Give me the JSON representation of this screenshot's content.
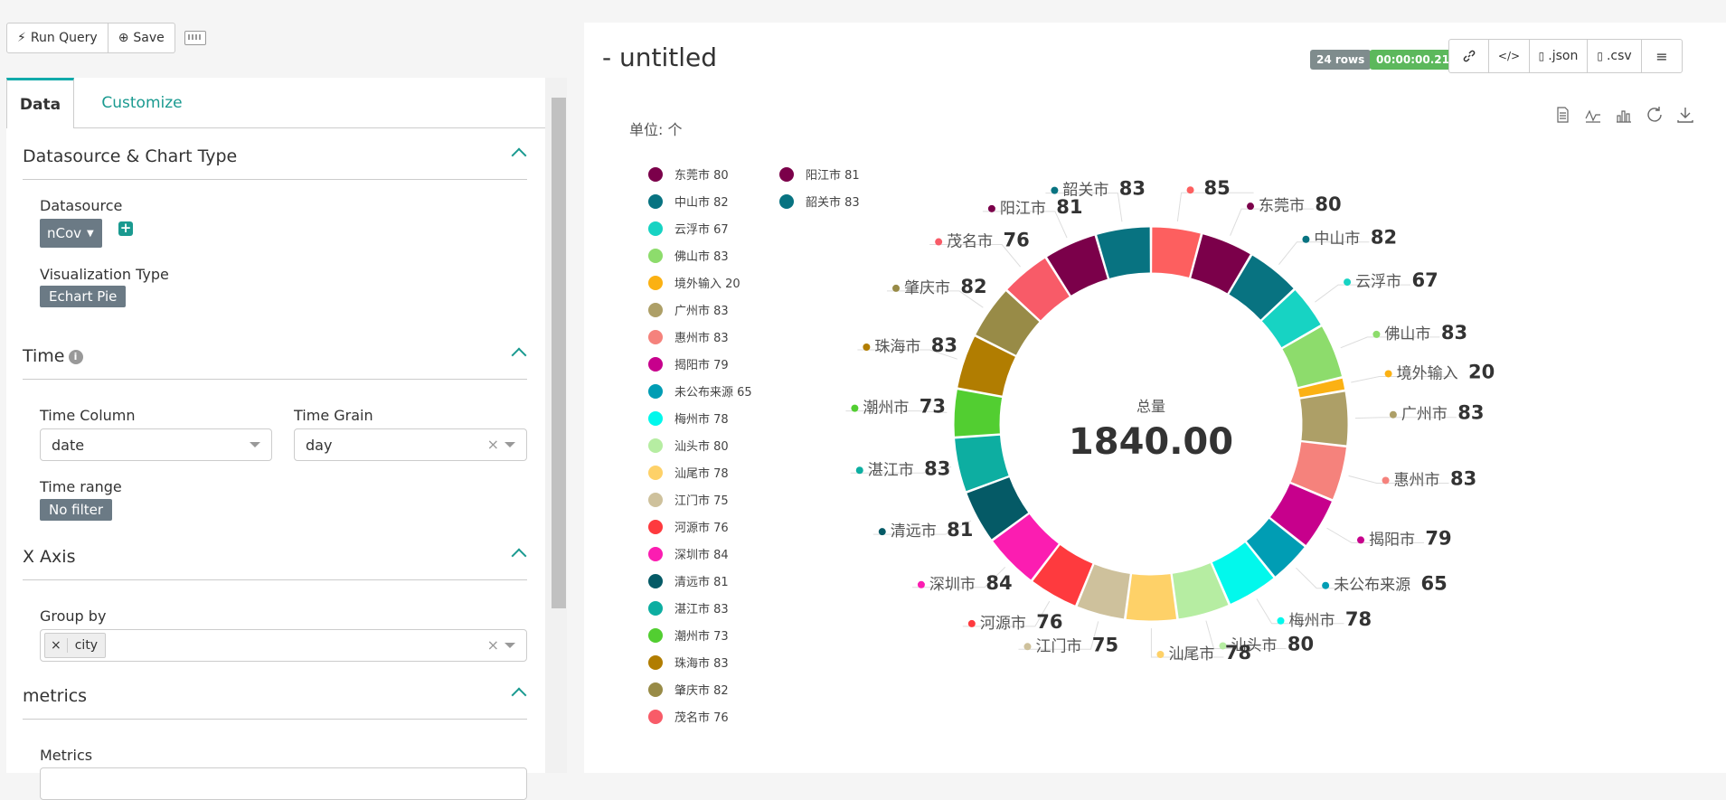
{
  "toolbar": {
    "run_label": "Run Query",
    "save_label": "Save"
  },
  "tabs": {
    "data": "Data",
    "customize": "Customize"
  },
  "sections": {
    "datasource": {
      "title": "Datasource & Chart Type",
      "datasource_label": "Datasource",
      "datasource_value": "nCov",
      "viz_label": "Visualization Type",
      "viz_value": "Echart Pie"
    },
    "time": {
      "title": "Time",
      "time_column_label": "Time Column",
      "time_column_value": "date",
      "time_grain_label": "Time Grain",
      "time_grain_value": "day",
      "time_range_label": "Time range",
      "time_range_value": "No filter"
    },
    "xaxis": {
      "title": "X Axis",
      "group_by_label": "Group by",
      "group_by_tag": "city"
    },
    "metrics": {
      "title": "metrics",
      "metrics_label": "Metrics"
    }
  },
  "header": {
    "title": "- untitled",
    "rows_badge": "24 rows",
    "time_badge": "00:00:00.21",
    "json_label": ".json",
    "csv_label": ".csv"
  },
  "colors": {
    "accent": "#1a9a90",
    "rows_badge": "#7f8c8d",
    "time_badge": "#5cb85c"
  },
  "chart_data": {
    "type": "pie",
    "unit_label": "单位: 个",
    "center_label": "总量",
    "center_value": "1840.00",
    "total": 1840,
    "legend_position": "left",
    "slices": [
      {
        "name": "茂名市",
        "value": 76,
        "color": "#fd5f5f"
      },
      {
        "name": "东莞市",
        "value": 80,
        "color": "#7b004a"
      },
      {
        "name": "中山市",
        "value": 82,
        "color": "#087381"
      },
      {
        "name": "云浮市",
        "value": 67,
        "color": "#17d3c3"
      },
      {
        "name": "佛山市",
        "value": 83,
        "color": "#8ddc6c"
      },
      {
        "name": "境外输入",
        "value": 20,
        "color": "#fbb113"
      },
      {
        "name": "广州市",
        "value": 83,
        "color": "#ad9f67"
      },
      {
        "name": "惠州市",
        "value": 83,
        "color": "#f5827c"
      },
      {
        "name": "揭阳市",
        "value": 79,
        "color": "#c7008c"
      },
      {
        "name": "未公布来源",
        "value": 65,
        "color": "#009db4"
      },
      {
        "name": "梅州市",
        "value": 78,
        "color": "#02f8ec"
      },
      {
        "name": "汕头市",
        "value": 80,
        "color": "#b6eda2"
      },
      {
        "name": "汕尾市",
        "value": 78,
        "color": "#fed168"
      },
      {
        "name": "江门市",
        "value": 75,
        "color": "#cec19c"
      },
      {
        "name": "河源市",
        "value": 76,
        "color": "#fe3a3e"
      },
      {
        "name": "深圳市",
        "value": 84,
        "color": "#fb1db1"
      },
      {
        "name": "清远市",
        "value": 81,
        "color": "#055a66"
      },
      {
        "name": "湛江市",
        "value": 83,
        "color": "#0daea1"
      },
      {
        "name": "潮州市",
        "value": 73,
        "color": "#52ce31"
      },
      {
        "name": "珠海市",
        "value": 83,
        "color": "#b17d01"
      },
      {
        "name": "肇庆市",
        "value": 82,
        "color": "#988b47"
      },
      {
        "name": "茂名市",
        "value": 76,
        "color": "#f85b68"
      },
      {
        "name": "阳江市",
        "value": 81,
        "color": "#7b004a"
      },
      {
        "name": "韶关市",
        "value": 83,
        "color": "#087381"
      }
    ],
    "legend": [
      {
        "name": "东莞市",
        "value": 80,
        "color": "#7b004a"
      },
      {
        "name": "中山市",
        "value": 82,
        "color": "#087381"
      },
      {
        "name": "云浮市",
        "value": 67,
        "color": "#17d3c3"
      },
      {
        "name": "佛山市",
        "value": 83,
        "color": "#8ddc6c"
      },
      {
        "name": "境外输入",
        "value": 20,
        "color": "#fbb113"
      },
      {
        "name": "广州市",
        "value": 83,
        "color": "#ad9f67"
      },
      {
        "name": "惠州市",
        "value": 83,
        "color": "#f5827c"
      },
      {
        "name": "揭阳市",
        "value": 79,
        "color": "#c7008c"
      },
      {
        "name": "未公布来源",
        "value": 65,
        "color": "#009db4"
      },
      {
        "name": "梅州市",
        "value": 78,
        "color": "#02f8ec"
      },
      {
        "name": "汕头市",
        "value": 80,
        "color": "#b6eda2"
      },
      {
        "name": "汕尾市",
        "value": 78,
        "color": "#fed168"
      },
      {
        "name": "江门市",
        "value": 75,
        "color": "#cec19c"
      },
      {
        "name": "河源市",
        "value": 76,
        "color": "#fe3a3e"
      },
      {
        "name": "深圳市",
        "value": 84,
        "color": "#fb1db1"
      },
      {
        "name": "清远市",
        "value": 81,
        "color": "#055a66"
      },
      {
        "name": "湛江市",
        "value": 83,
        "color": "#0daea1"
      },
      {
        "name": "潮州市",
        "value": 73,
        "color": "#52ce31"
      },
      {
        "name": "珠海市",
        "value": 83,
        "color": "#b17d01"
      },
      {
        "name": "肇庆市",
        "value": 82,
        "color": "#988b47"
      },
      {
        "name": "茂名市",
        "value": 76,
        "color": "#f85b68"
      },
      {
        "name": "阳江市",
        "value": 81,
        "color": "#7b004a"
      },
      {
        "name": "韶关市",
        "value": 83,
        "color": "#087381"
      }
    ],
    "first_label_value": "85"
  }
}
